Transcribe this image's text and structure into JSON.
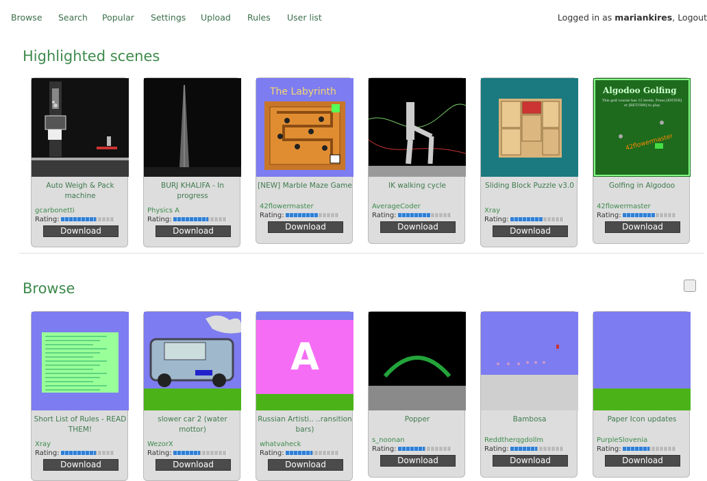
{
  "nav": {
    "items": [
      "Browse",
      "Search",
      "Popular",
      "Settings",
      "Upload",
      "Rules",
      "User list"
    ],
    "login_prefix": "Logged in as ",
    "username": "mariankires",
    "logout": "Logout"
  },
  "highlighted": {
    "heading": "Highlighted scenes",
    "cards": [
      {
        "title": "Auto Weigh & Pack machine",
        "author": "gcarbonetti",
        "rating_label": "Rating:",
        "rating": 0.65,
        "download": "Download",
        "thumb": "weigh"
      },
      {
        "title": "BURJ KHALIFA - In progress",
        "author": "Physics A",
        "rating_label": "Rating:",
        "rating": 0.65,
        "download": "Download",
        "thumb": "burj"
      },
      {
        "title": "[NEW] Marble Maze Game",
        "author": "42flowermaster",
        "rating_label": "Rating:",
        "rating": 0.6,
        "download": "Download",
        "thumb": "maze",
        "thumb_text": "The Labyrinth"
      },
      {
        "title": "IK walking cycle",
        "author": "AverageCoder",
        "rating_label": "Rating:",
        "rating": 0.6,
        "download": "Download",
        "thumb": "ik"
      },
      {
        "title": "Sliding Block Puzzle v3.0",
        "author": "Xray",
        "rating_label": "Rating:",
        "rating": 0.6,
        "download": "Download",
        "thumb": "sliding"
      },
      {
        "title": "Golfing in Algodoo",
        "author": "42flowermaster",
        "rating_label": "Rating:",
        "rating": 0.6,
        "download": "Download",
        "thumb": "golf",
        "thumb_text": "Algodoo Golfing",
        "thumb_sub": "This golf course has 12 levels. Press [ENTER] or [RETURN] to play",
        "thumb_sig": "42flowermaster"
      }
    ]
  },
  "browse": {
    "heading": "Browse",
    "cards": [
      {
        "title": "Short List of Rules - READ THEM!",
        "author": "Xray",
        "rating_label": "Rating:",
        "rating": 0.65,
        "download": "Download",
        "thumb": "rules"
      },
      {
        "title": "slower car 2 (water mottor)",
        "author": "WezorX",
        "rating_label": "Rating:",
        "rating": 0.5,
        "download": "Download",
        "thumb": "car"
      },
      {
        "title": "Russian Artisti.. ..ransition bars)",
        "author": "whatvaheck",
        "rating_label": "Rating:",
        "rating": 0.5,
        "download": "Download",
        "thumb": "letterA",
        "thumb_text": "A"
      },
      {
        "title": "Popper",
        "author": "s_noonan",
        "rating_label": "Rating:",
        "rating": 0.5,
        "download": "Download",
        "thumb": "popper"
      },
      {
        "title": "Bambosa",
        "author": "Reddtherqgdollm",
        "rating_label": "Rating:",
        "rating": 0.5,
        "download": "Download",
        "thumb": "bambosa"
      },
      {
        "title": "Paper Icon updates",
        "author": "PurpleSlovenia",
        "rating_label": "Rating:",
        "rating": 0.5,
        "download": "Download",
        "thumb": "paper"
      }
    ]
  }
}
